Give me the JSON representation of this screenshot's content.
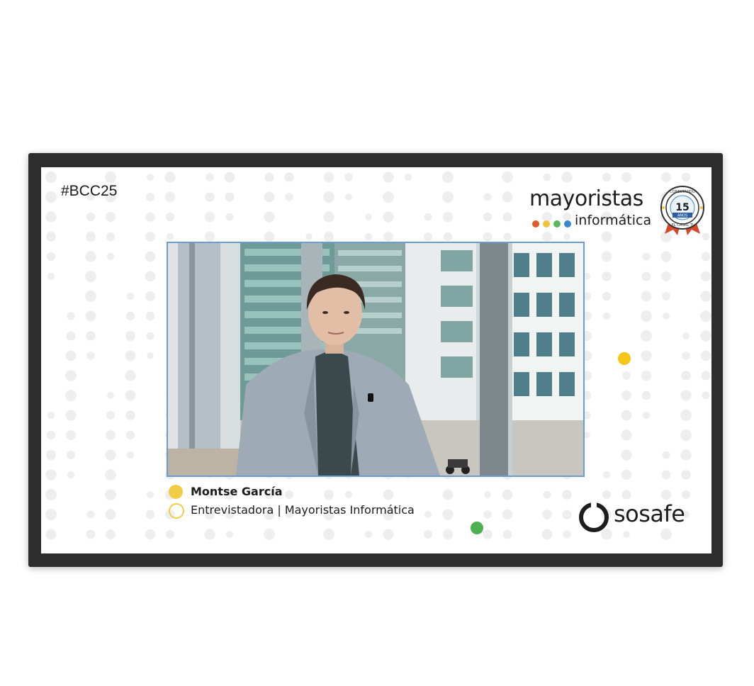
{
  "event": {
    "hashtag": "#BCC25"
  },
  "brand": {
    "wordmark": "mayoristas",
    "subword": "informática",
    "dot_colors": [
      "#e35a2a",
      "#f0c43a",
      "#5cb85c",
      "#3a86c8"
    ],
    "badge": {
      "top_text": "CONECTANDO",
      "number": "15",
      "years": "AÑOS",
      "bottom_text": "EL CANAL TI",
      "icon": "anniversary-seal-icon"
    }
  },
  "video": {
    "description_icon": "interview-video-frame"
  },
  "lower_third": {
    "name": "Montse García",
    "role": "Entrevistadora | Mayoristas Informática",
    "accent_color": "#f1cc47"
  },
  "sponsor": {
    "name": "sosafe",
    "icon": "sosafe-logo-icon"
  },
  "accent_colors": {
    "yellow": "#f5c518",
    "green": "#4caf50"
  }
}
